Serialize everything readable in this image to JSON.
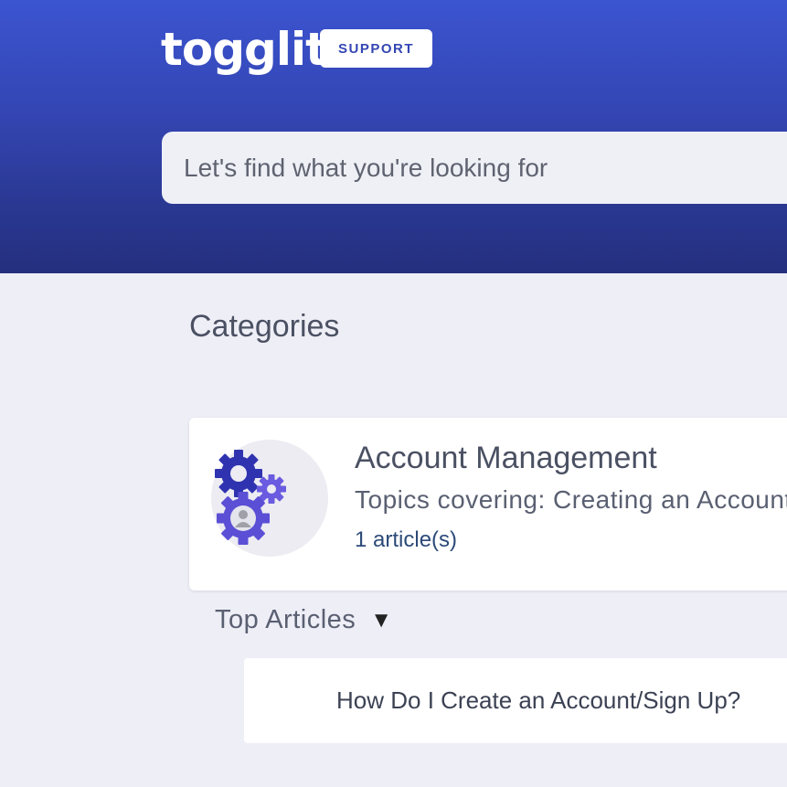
{
  "header": {
    "logo_text": "togglit",
    "badge_label": "SUPPORT",
    "search_placeholder": "Let's find what you're looking for"
  },
  "main": {
    "categories_title": "Categories",
    "category": {
      "title": "Account Management",
      "description": "Topics covering: Creating an Account",
      "article_count": "1 article(s)",
      "icon": "gears-user-icon"
    },
    "top_articles": {
      "label": "Top Articles",
      "toggle_icon": "caret-down-icon",
      "items": [
        {
          "title": "How Do I Create an Account/Sign Up?"
        }
      ]
    }
  },
  "colors": {
    "hero_top": "#3b54d0",
    "hero_bottom": "#242f7e",
    "gear_dark": "#2f33b0",
    "gear_light": "#6a5be0",
    "page_bg": "#eeeef6"
  }
}
